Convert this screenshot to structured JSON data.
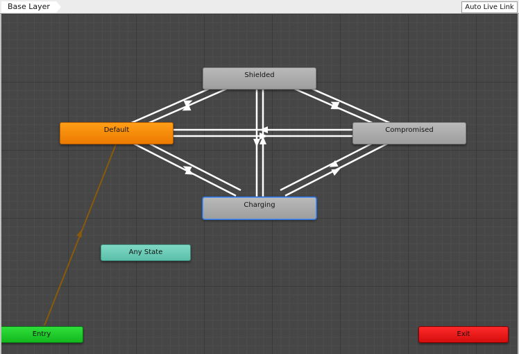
{
  "toolbar": {
    "breadcrumb": "Base Layer",
    "live_link_label": "Auto Live Link"
  },
  "states": {
    "shielded": "Shielded",
    "default": "Default",
    "compromised": "Compromised",
    "charging": "Charging",
    "any_state": "Any State",
    "entry": "Entry",
    "exit": "Exit"
  },
  "colors": {
    "default_state": "#f08a00",
    "any_state": "#6ccbb6",
    "entry": "#1fcf2b",
    "exit": "#e81414",
    "regular_state": "#a9a9a9",
    "entry_transition": "#8a5a0b",
    "transition": "#ffffff"
  }
}
